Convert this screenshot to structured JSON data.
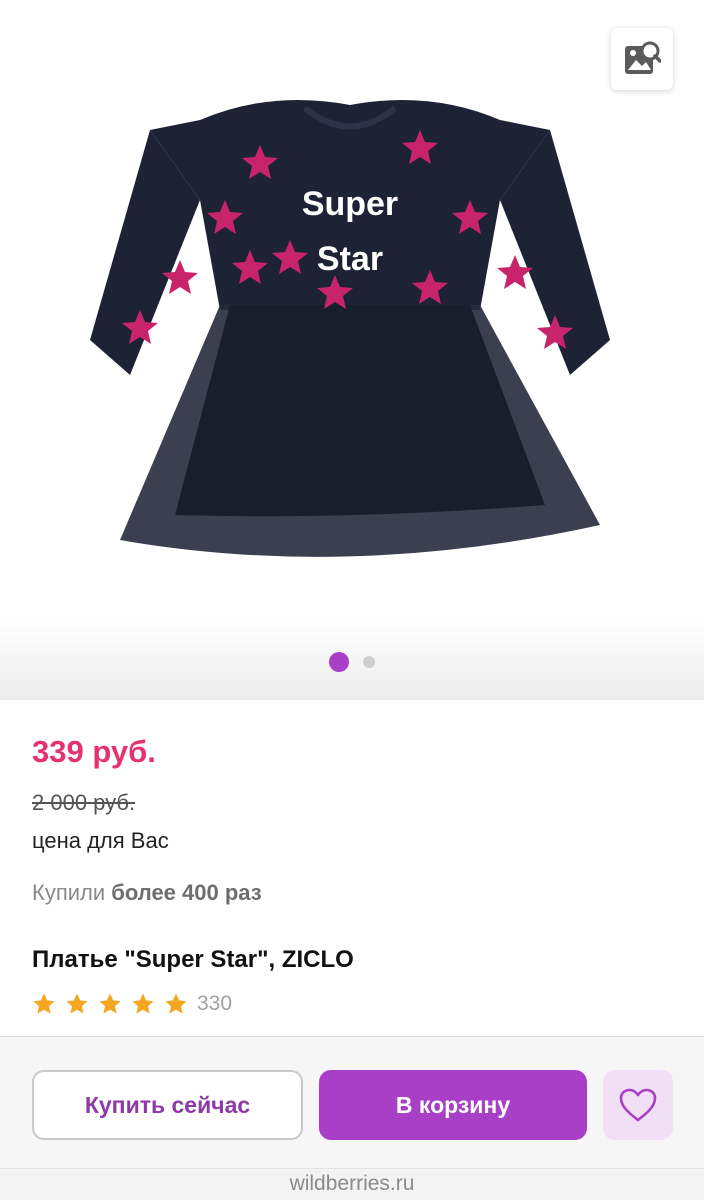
{
  "gallery": {
    "slides_total": 2,
    "active_slide": 1,
    "print_text_line1": "Super",
    "print_text_line2": "Star"
  },
  "product": {
    "price": "339 руб.",
    "old_price": "2 000 руб.",
    "price_note": "цена для Вас",
    "bought_prefix": "Купили",
    "bought_value": "более 400 раз",
    "title": "Платье \"Super Star\", ZICLO",
    "rating_stars": 5,
    "review_count": "330"
  },
  "actions": {
    "buy_now_label": "Купить сейчас",
    "add_to_cart_label": "В корзину"
  },
  "footer": {
    "domain": "wildberries.ru"
  },
  "colors": {
    "accent": "#a93fc7",
    "price": "#e5326f",
    "star": "#f5a623"
  }
}
